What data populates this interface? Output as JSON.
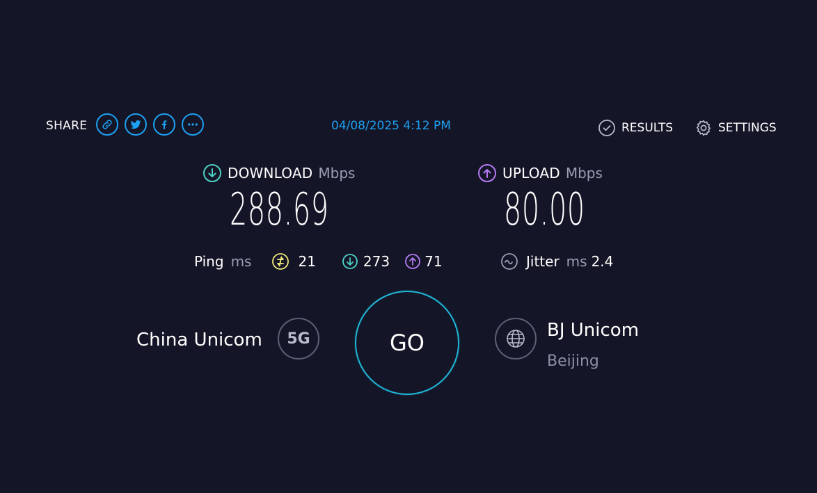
{
  "share": {
    "label": "SHARE",
    "buttons": [
      "link-icon",
      "twitter-icon",
      "facebook-icon",
      "more-icon"
    ]
  },
  "datetime": "04/08/2025 4:12 PM",
  "nav": {
    "results": "RESULTS",
    "settings": "SETTINGS"
  },
  "download": {
    "label": "DOWNLOAD",
    "unit": "Mbps",
    "value": "288.69"
  },
  "upload": {
    "label": "UPLOAD",
    "unit": "Mbps",
    "value": "80.00"
  },
  "ping": {
    "label": "Ping",
    "unit": "ms",
    "idle": "21",
    "download": "273",
    "upload": "71"
  },
  "jitter": {
    "label": "Jitter",
    "unit": "ms",
    "value": "2.4"
  },
  "isp": {
    "name": "China Unicom",
    "badge": "5G"
  },
  "go_label": "GO",
  "server": {
    "name": "BJ Unicom",
    "location": "Beijing"
  },
  "colors": {
    "background": "#141628",
    "accent": "#1da1f2",
    "download": "#4fd1c5",
    "upload": "#b77af4",
    "ping_idle": "#f4e97a",
    "go_ring": "#1fb6d6"
  }
}
